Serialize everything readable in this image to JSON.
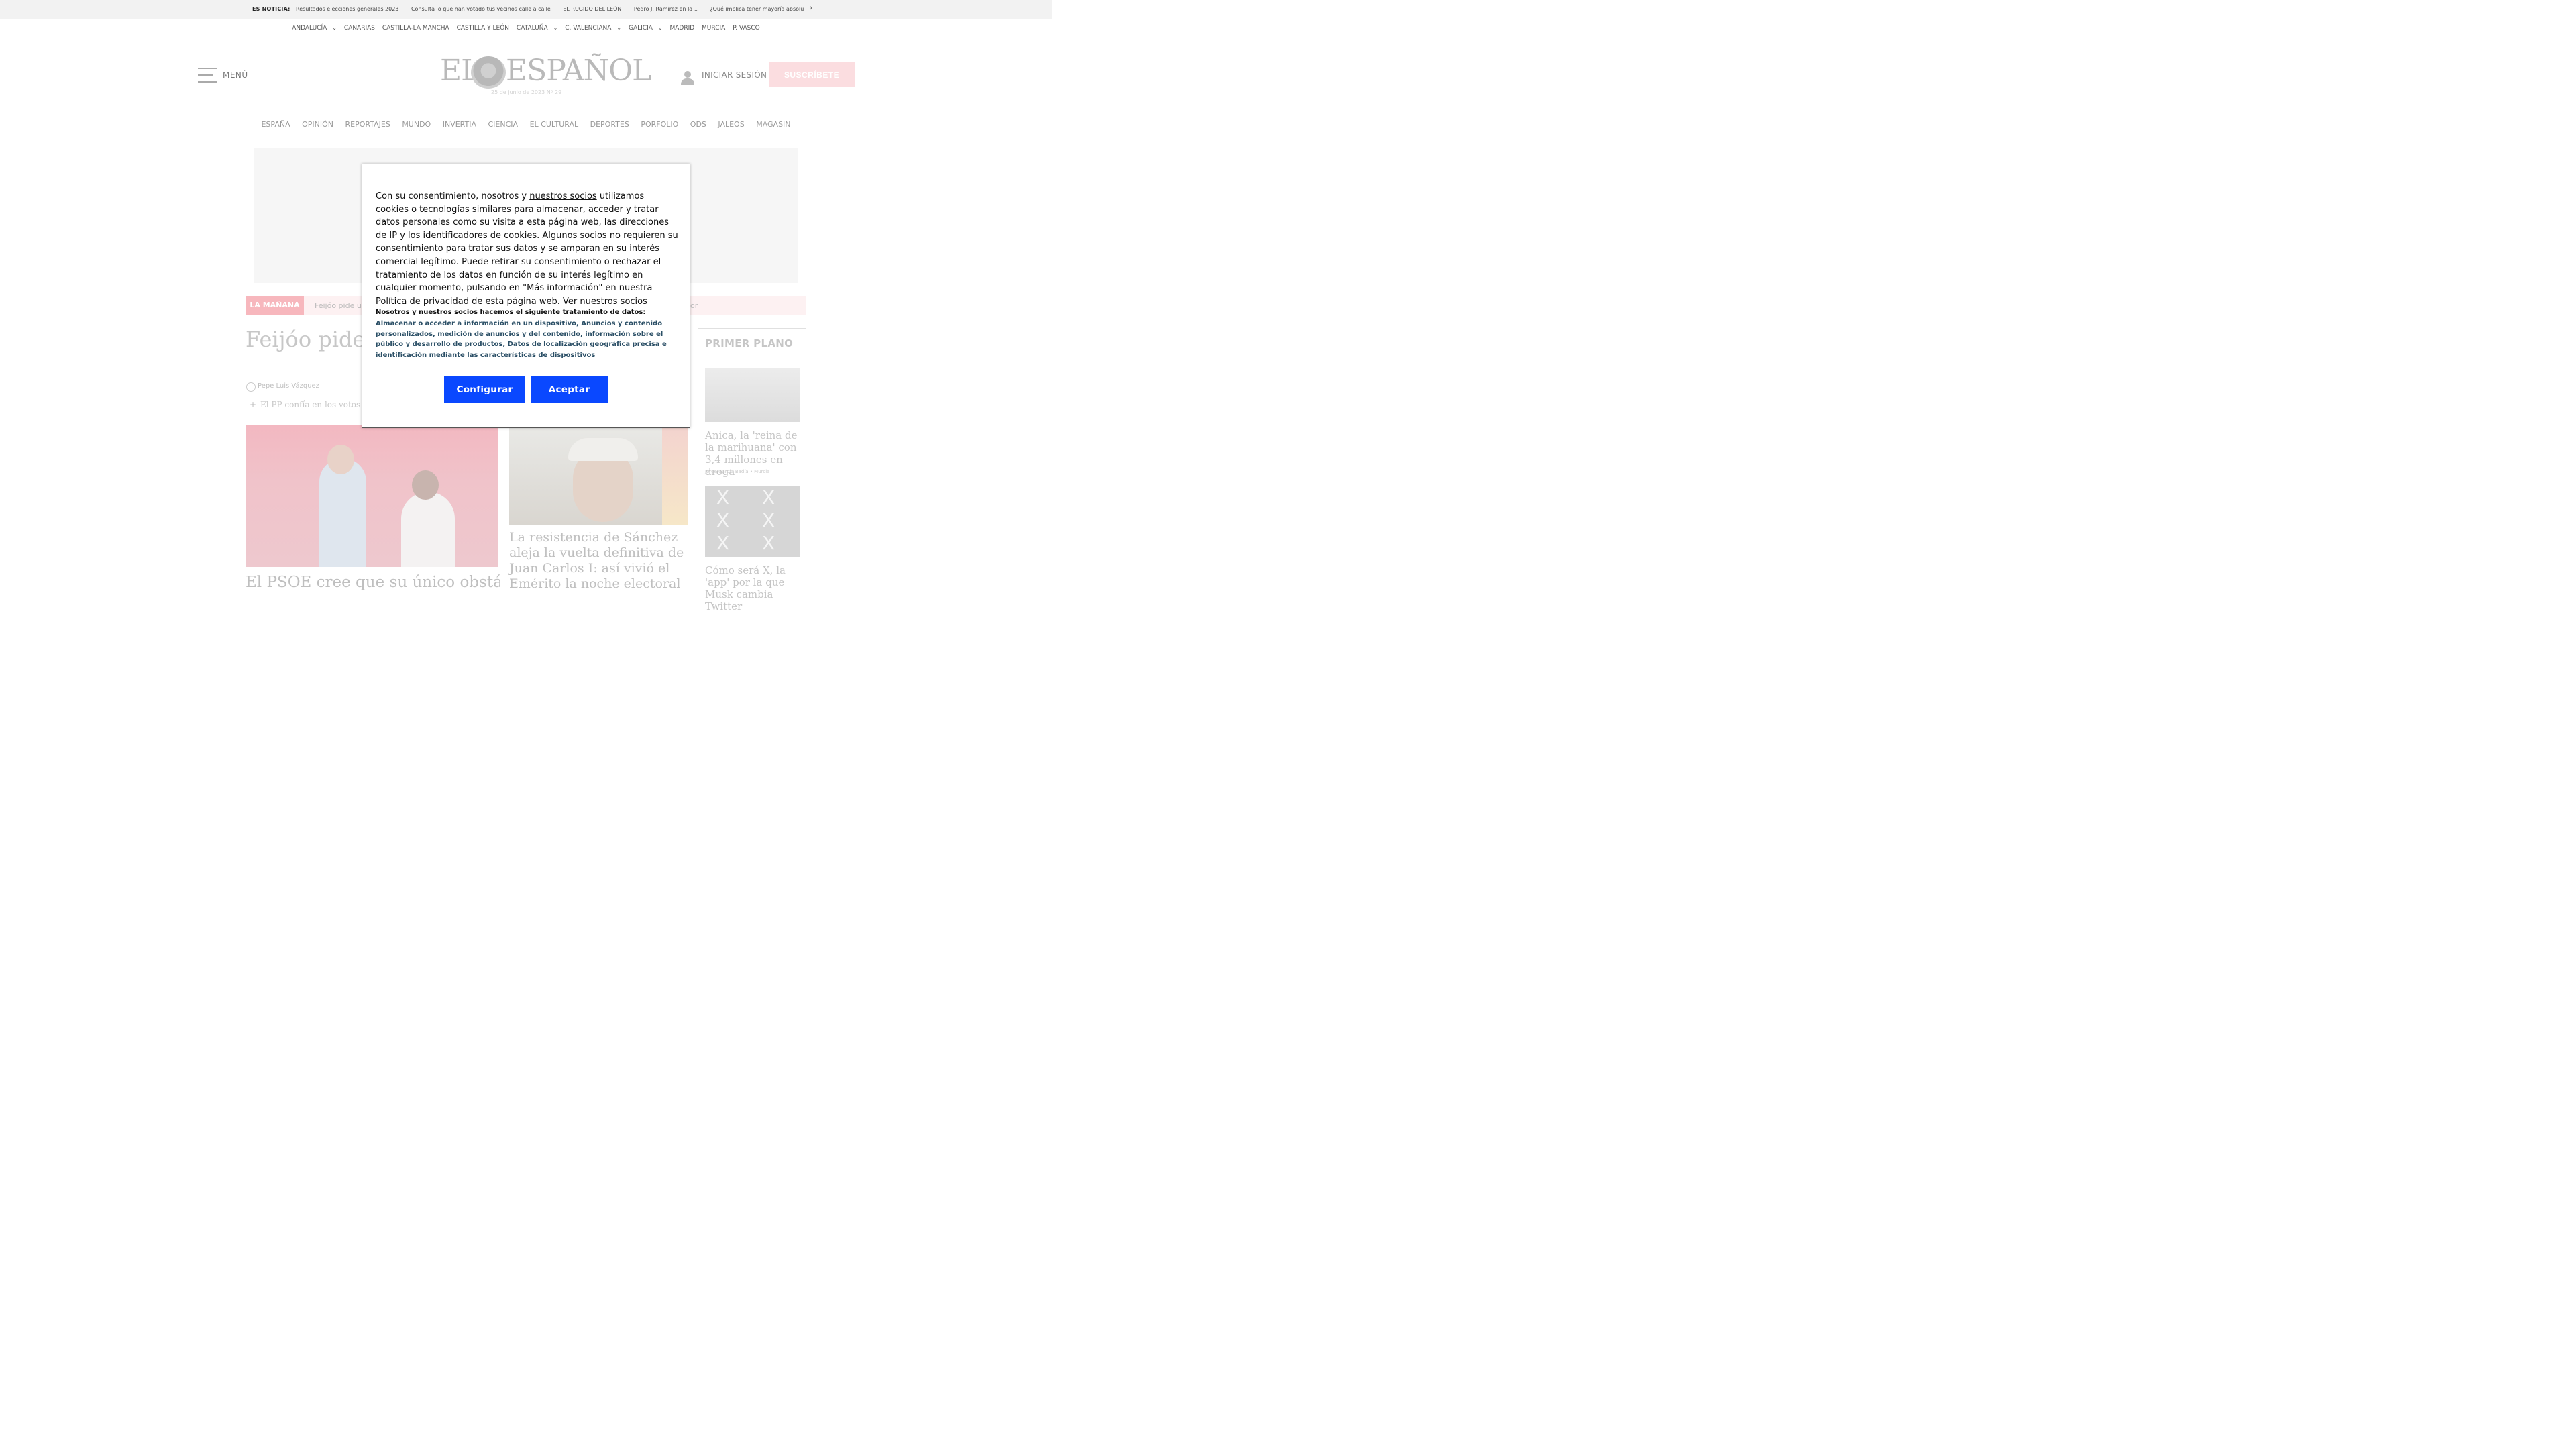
{
  "topbar": {
    "label": "ES NOTICIA:",
    "links": [
      "Resultados elecciones generales 2023",
      "Consulta lo que han votado tus vecinos calle a calle",
      "EL RUGIDO DEL LEÓN",
      "Pedro J. Ramírez en la 1",
      "¿Qué implica tener mayoría absoluta en el Senado?"
    ],
    "next_icon": "chevron-right-icon"
  },
  "regions": [
    "ANDALUCÍA",
    "CANARIAS",
    "CASTILLA-LA MANCHA",
    "CASTILLA Y LEÓN",
    "CATALUÑA",
    "C. VALENCIANA",
    "GALICIA",
    "MADRID",
    "MURCIA",
    "P. VASCO"
  ],
  "header": {
    "menu_label": "MENÚ",
    "logo_left": "EL",
    "logo_right": "ESPAÑOL",
    "dateline": "25 de junio de 2023 Nº 29",
    "login_label": "INICIAR SESIÓN",
    "subscribe_label": "SUSCRÍBETE"
  },
  "sections": [
    "ESPAÑA",
    "OPINIÓN",
    "REPORTAJES",
    "MUNDO",
    "INVERTIA",
    "CIENCIA",
    "EL CULTURAL",
    "DEPORTES",
    "PORFOLIO",
    "ODS",
    "JALEOS",
    "MAGASIN"
  ],
  "manana": {
    "tag": "LA MAÑANA",
    "text_left": "Feijóo pide u",
    "text_right": "lor"
  },
  "main": {
    "headline": "Feijóo pide u hasta despu",
    "author": "Pepe Luis Vázquez",
    "related": "El PP confía en los votos d",
    "story2_title": "El PSOE cree que su único obstáculo",
    "story3_title": "La resistencia de Sánchez aleja la vuelta definitiva de Juan Carlos I: así vivió el Emérito la noche electoral"
  },
  "primer_plano": {
    "heading": "PRIMER PLANO",
    "item1_title": "Anica, la 'reina de la marihuana' con 3,4 millones en droga",
    "item1_meta": "Jorge García Badía • Murcia",
    "item2_image_text": "X X X X X X X X X",
    "item2_title": "Cómo será X, la 'app' por la que Musk cambia Twitter"
  },
  "consent": {
    "text_before_link": "Con su consentimiento, nosotros y ",
    "partners_link": "nuestros socios",
    "text_after_link": " utilizamos cookies o tecnologías similares para almacenar, acceder y tratar datos personales como su visita a esta página web, las direcciones de IP y los identificadores de cookies. Algunos socios no requieren su consentimiento para tratar sus datos y se amparan en su interés comercial legítimo. Puede retirar su consentimiento o rechazar el tratamiento de los datos en función de su interés legítimo en cualquier momento, pulsando en \"Más información\" en nuestra Política de privacidad de esta página web. ",
    "see_partners_link": "Ver nuestros socios",
    "purposes_heading": "Nosotros y nuestros socios hacemos el siguiente tratamiento de datos:",
    "purposes": "Almacenar o acceder a información en un dispositivo, Anuncios y contenido personalizados, medición de anuncios y del contenido, información sobre el público y desarrollo de productos, Datos de localización geográfica precisa e identificación mediante las características de dispositivos",
    "configure_label": "Configurar",
    "accept_label": "Aceptar"
  },
  "colors": {
    "accept_button": "#0a48ff",
    "subscribe_button": "#fbdde0",
    "manana_tag": "#f7b7bd",
    "purposes_text": "#2b4f66"
  }
}
